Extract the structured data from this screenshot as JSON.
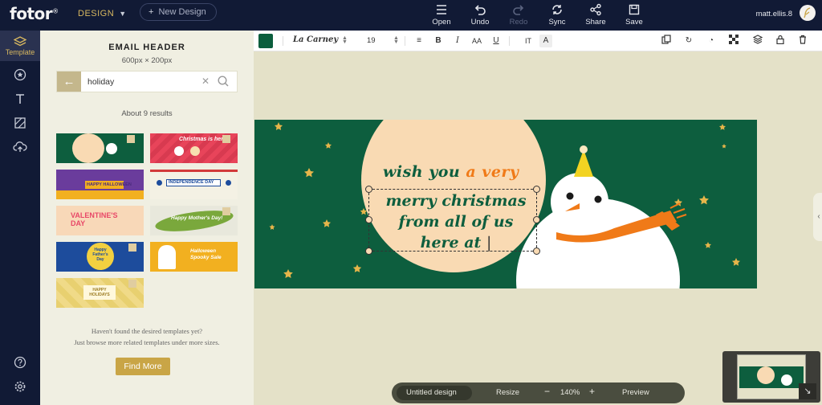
{
  "app": {
    "logo": "fotor",
    "design_menu": "DESIGN",
    "new_design": "New Design",
    "user": "matt.ellis.8"
  },
  "toolbar": [
    {
      "label": "Open",
      "icon": "menu-icon"
    },
    {
      "label": "Undo",
      "icon": "undo-icon"
    },
    {
      "label": "Redo",
      "icon": "redo-icon",
      "disabled": true
    },
    {
      "label": "Sync",
      "icon": "sync-icon"
    },
    {
      "label": "Share",
      "icon": "share-icon"
    },
    {
      "label": "Save",
      "icon": "save-icon"
    }
  ],
  "rail": {
    "items": [
      {
        "label": "Template",
        "icon": "template-icon",
        "active": true
      },
      {
        "icon": "sticker-icon"
      },
      {
        "icon": "text-icon"
      },
      {
        "icon": "background-icon"
      },
      {
        "icon": "upload-icon"
      },
      {
        "icon": "help-icon"
      },
      {
        "icon": "settings-icon"
      }
    ]
  },
  "panel": {
    "title": "EMAIL HEADER",
    "subtitle": "600px × 200px",
    "search_value": "holiday",
    "results": "About 9 results",
    "hint_line1": "Haven't found the desired templates yet?",
    "hint_line2": "Just browse more related templates under more sizes.",
    "find_more": "Find More",
    "thumbs": [
      {
        "name": "christmas-snowman-green",
        "text": "",
        "bg": "#0d5e3e"
      },
      {
        "name": "christmas-is-here",
        "text": "Christmas is here!",
        "bg": "#e8445a"
      },
      {
        "name": "happy-halloween",
        "text": "HAPPY HALLOWEEN",
        "bg": "#6a3c9c"
      },
      {
        "name": "independence-day",
        "text": "INDEPENDENCE DAY",
        "bg": "#f4f1e4"
      },
      {
        "name": "valentines-day",
        "text": "VALENTINE'S DAY",
        "bg": "#f8d8b8"
      },
      {
        "name": "happy-mothers-day",
        "text": "Happy Mother's Day!",
        "bg": "#e8e8dc"
      },
      {
        "name": "happy-fathers-day",
        "text": "Happy Father's Day",
        "bg": "#1d4c9c"
      },
      {
        "name": "halloween-spooky-sale",
        "text": "Halloween Spooky Sale",
        "bg": "#f2b020"
      },
      {
        "name": "happy-holidays",
        "text": "HAPPY HOLIDAYS",
        "bg": "#e8d070"
      }
    ]
  },
  "text_bar": {
    "color": "#0b5e3d",
    "font": "La Carney",
    "size": "19"
  },
  "banner": {
    "line1_a": "wish you",
    "line1_b": "a very",
    "line2": "merry christmas",
    "line3": "from all of us",
    "line4": "here at",
    "bg": "#0d5e3e",
    "circle": "#f9dab3",
    "accent": "#f07a18"
  },
  "bottom": {
    "design_name": "Untitled design",
    "resize": "Resize",
    "zoom": "140%",
    "preview": "Preview"
  }
}
